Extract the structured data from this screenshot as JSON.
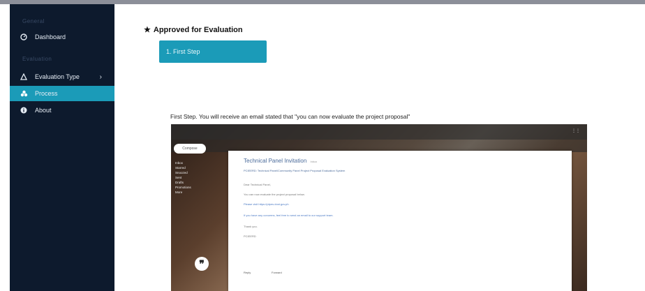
{
  "sidebar": {
    "section_top": "General",
    "section_mid": "Evaluation",
    "items": [
      {
        "label": "Dashboard",
        "icon": "dashboard-icon"
      },
      {
        "label": "Evaluation Type",
        "icon": "warning-triangle-icon"
      },
      {
        "label": "Process",
        "icon": "process-icon"
      },
      {
        "label": "About",
        "icon": "info-icon"
      }
    ],
    "active_item": "Process",
    "colors": {
      "bg": "#0d1a2d",
      "active": "#1b9bb8"
    }
  },
  "main": {
    "title": "Approved for Evaluation",
    "step_button": "1. First Step",
    "step_desc": "First Step. You will receive an email stated that \"you can now evaluate the project proposal\""
  },
  "email": {
    "compose": "Compose",
    "folders": [
      "Inbox",
      "Starred",
      "Snoozed",
      "Sent",
      "Drafts",
      "Promotions",
      "More"
    ],
    "subject": "Technical Panel Invitation",
    "subject_tag": "Inbox",
    "header": "PCIEERD: Technical Panel/Community Panel Project Proposal Evaluation System",
    "lines": [
      "Dear Technical Panel,",
      "You can now evaluate the project proposal below.",
      "Please visit https://ptpes.dost.gov.ph",
      "If you have any concerns, feel free to send an email to our support team.",
      "Thank you.",
      "PCIEERD"
    ],
    "reply": "Reply",
    "forward": "Forward"
  }
}
